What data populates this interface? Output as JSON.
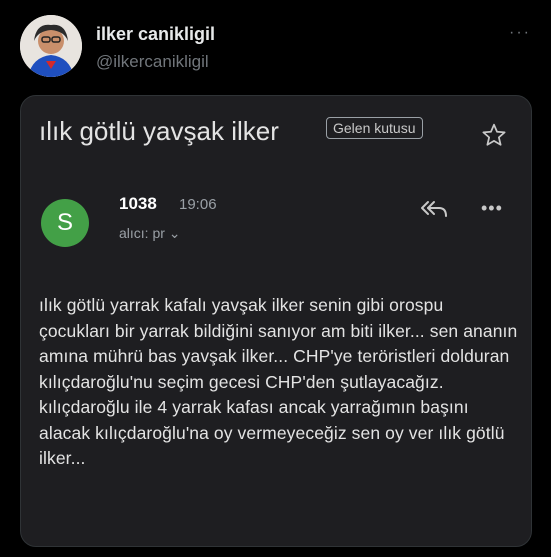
{
  "tweet": {
    "author_name": "ilker canikligil",
    "handle": "@ilkercanikligil",
    "more_label": "···"
  },
  "email": {
    "subject": "ılık götlü yavşak ilker",
    "label": "Gelen kutusu",
    "icons": {
      "star": "star-icon",
      "reply": "reply-all-icon",
      "more": "more-icon"
    },
    "sender": {
      "avatar_letter": "S",
      "avatar_color": "#43a047",
      "name": "1038",
      "time": "19:06",
      "recipient": "alıcı: pr ⌄"
    },
    "more_label": "•••",
    "body": "ılık götlü yarrak kafalı yavşak ilker senin gibi orospu çocukları bir yarrak bildiğini sanıyor am biti ilker... sen ananın amına mührü bas yavşak ilker... CHP'ye teröristleri dolduran kılıçdaroğlu'nu seçim gecesi CHP'den şutlayacağız. kılıçdaroğlu ile 4 yarrak kafası ancak yarrağımın başını alacak kılıçdaroğlu'na oy vermeyeceğiz sen oy ver ılık götlü ilker..."
  }
}
